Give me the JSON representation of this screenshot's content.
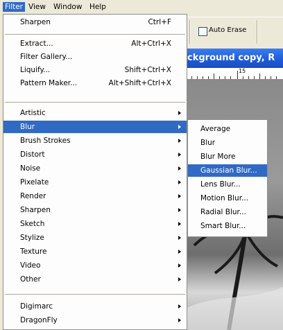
{
  "menubar": {
    "filter": "Filter",
    "view": "View",
    "window": "Window",
    "help": "Help"
  },
  "toolbar": {
    "auto_erase_label": "Auto Erase",
    "auto_erase_checked": false
  },
  "document": {
    "title": "ckground copy, R",
    "ruler_number": "15"
  },
  "filter_menu": {
    "sharpen_last": {
      "label": "Sharpen",
      "shortcut": "Ctrl+F"
    },
    "extract": {
      "label": "Extract...",
      "shortcut": "Alt+Ctrl+X"
    },
    "filter_gallery": {
      "label": "Filter Gallery..."
    },
    "liquify": {
      "label": "Liquify...",
      "shortcut": "Shift+Ctrl+X"
    },
    "pattern_maker": {
      "label": "Pattern Maker...",
      "shortcut": "Alt+Shift+Ctrl+X"
    },
    "artistic": "Artistic",
    "blur": "Blur",
    "brush_strokes": "Brush Strokes",
    "distort": "Distort",
    "noise": "Noise",
    "pixelate": "Pixelate",
    "render": "Render",
    "sharpen": "Sharpen",
    "sketch": "Sketch",
    "stylize": "Stylize",
    "texture": "Texture",
    "video": "Video",
    "other": "Other",
    "digimarc": "Digimarc",
    "dragonfly": "DragonFly"
  },
  "blur_submenu": {
    "average": "Average",
    "blur": "Blur",
    "blur_more": "Blur More",
    "gaussian_blur": "Gaussian Blur...",
    "lens_blur": "Lens Blur...",
    "motion_blur": "Motion Blur...",
    "radial_blur": "Radial Blur...",
    "smart_blur": "Smart Blur..."
  },
  "colors": {
    "highlight": "#316ac5",
    "menubar_bg": "#ece9d8"
  }
}
